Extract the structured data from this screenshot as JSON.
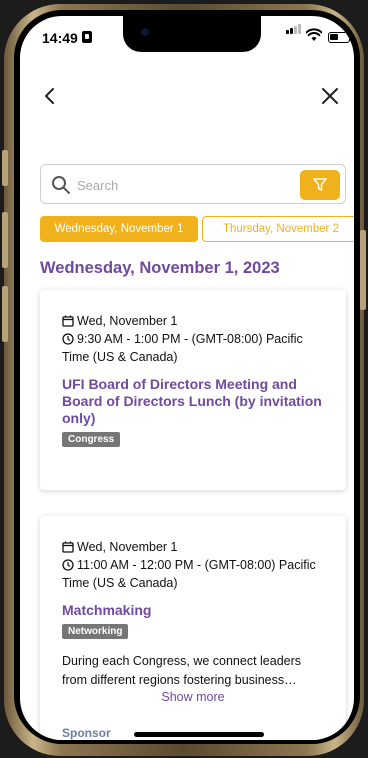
{
  "status_bar": {
    "time": "14:49"
  },
  "search": {
    "placeholder": "Search"
  },
  "date_tabs": [
    {
      "label": "Wednesday, November 1",
      "active": true
    },
    {
      "label": "Thursday, November 2",
      "active": false
    }
  ],
  "day_heading": "Wednesday, November 1, 2023",
  "events": [
    {
      "date": "Wed, November 1",
      "time": "9:30 AM - 1:00 PM - (GMT-08:00) Pacific Time (US & Canada)",
      "title": "UFI Board of Directors Meeting and Board of Directors Lunch (by invitation only)",
      "tag": "Congress"
    },
    {
      "date": "Wed, November 1",
      "time": "11:00 AM - 12:00 PM - (GMT-08:00) Pacific Time (US & Canada)",
      "title": "Matchmaking",
      "tag": "Networking",
      "description": "During each Congress, we connect leaders from different regions fostering business…",
      "show_more": "Show more",
      "sponsor_label": "Sponsor"
    }
  ],
  "colors": {
    "accent": "#f0b21c",
    "title_purple": "#6f4a9e",
    "tag_gray": "#767676"
  },
  "icons": [
    "back-arrow-icon",
    "close-icon",
    "search-icon",
    "filter-icon",
    "calendar-icon",
    "clock-icon"
  ]
}
